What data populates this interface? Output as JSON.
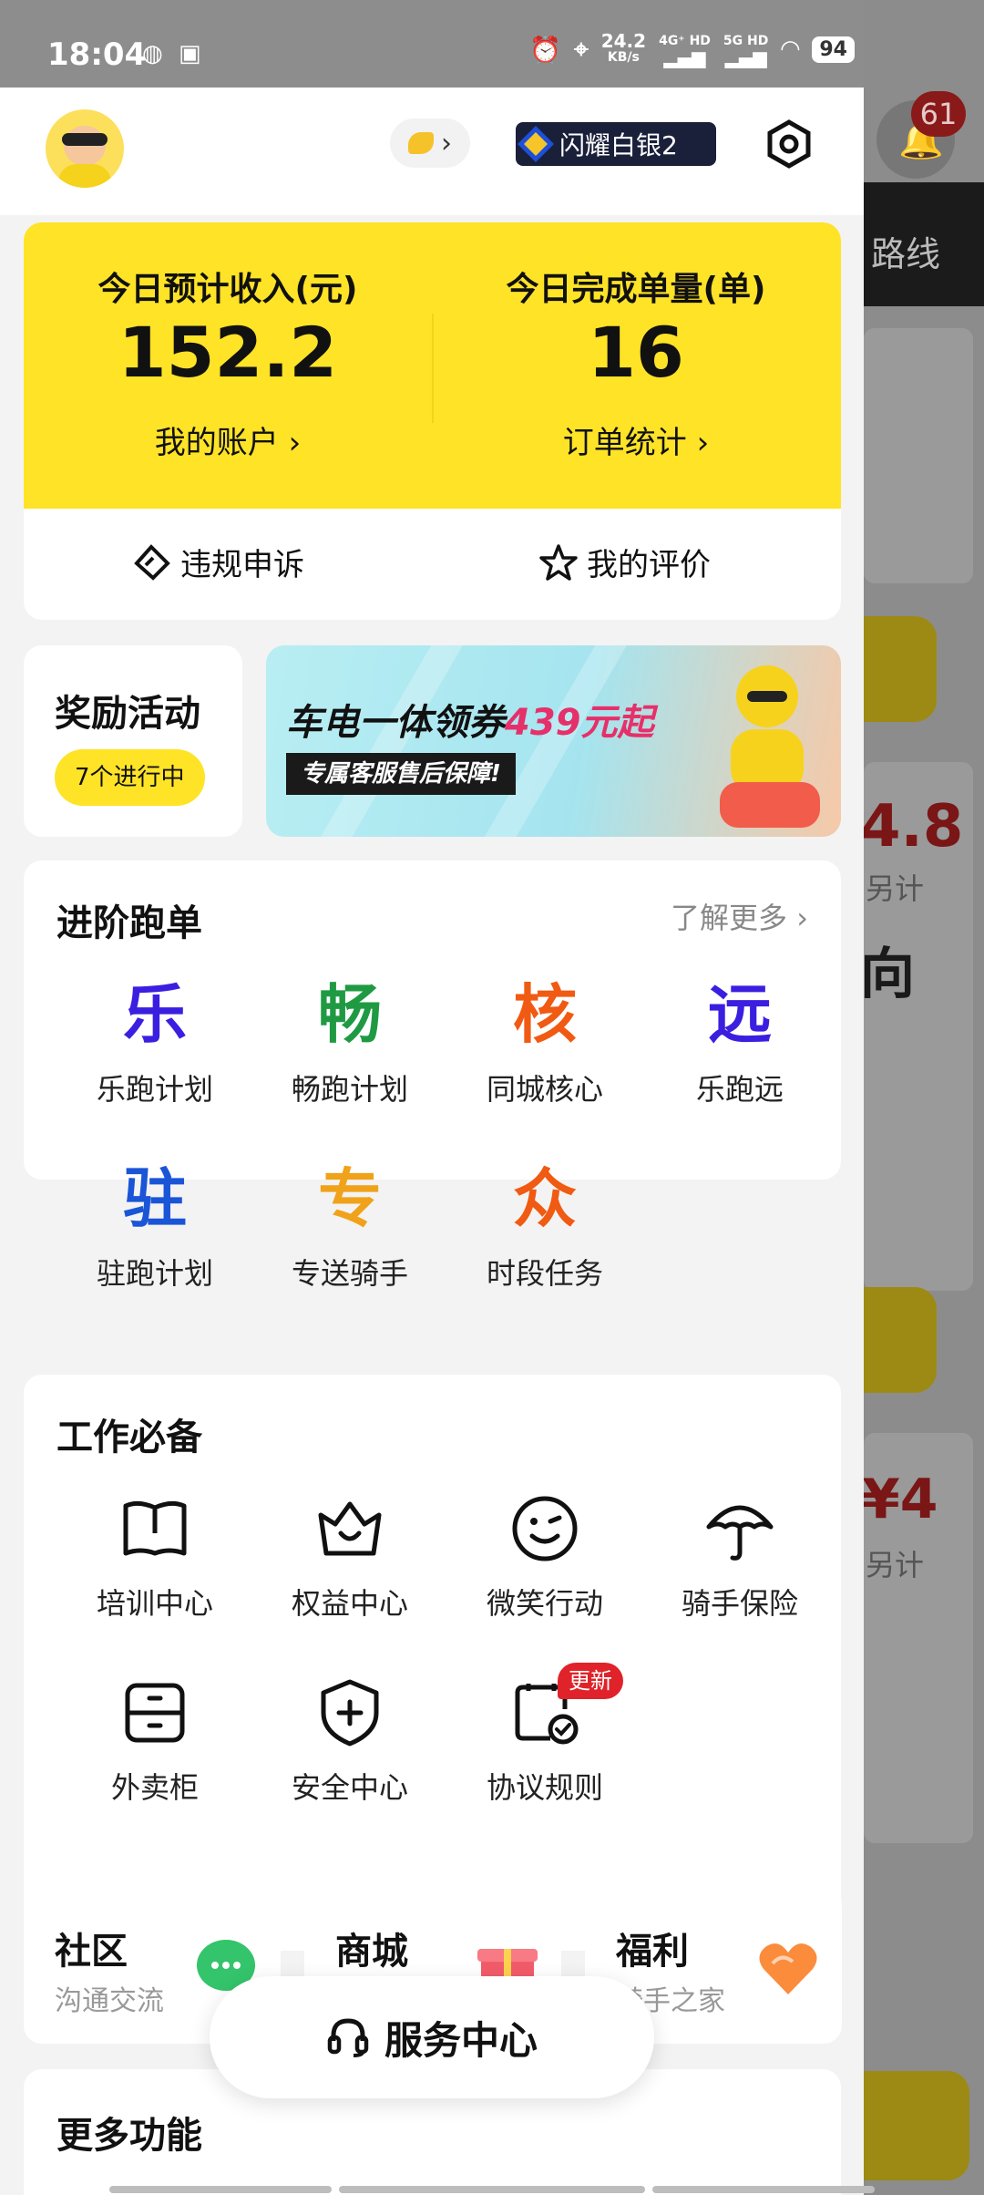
{
  "status_bar": {
    "time": "18:04",
    "speed_top": "24.2",
    "speed_unit": "KB/s",
    "net1": "4G⁺ HD",
    "net2": "5G HD",
    "battery": "94"
  },
  "background_app": {
    "route_label": "路线",
    "notification_count": "61",
    "amount1": "4.8",
    "amount2": "¥4",
    "note": "另计",
    "direction": "向"
  },
  "header": {
    "avatar": "avatar",
    "coin": "coin-icon",
    "rank": "闪耀白银2",
    "settings": "settings-icon"
  },
  "earnings": {
    "income_label": "今日预计收入(元)",
    "income_value": "152.2",
    "account_link": "我的账户",
    "orders_label": "今日完成单量(单)",
    "orders_value": "16",
    "stats_link": "订单统计"
  },
  "quick_actions": {
    "appeal": "违规申诉",
    "reviews": "我的评价"
  },
  "rewards": {
    "title": "奖励活动",
    "status": "7个进行中"
  },
  "banner": {
    "headline_a": "车电一体领券",
    "headline_b": "439元起",
    "sub": "专属客服售后保障!"
  },
  "advanced": {
    "title": "进阶跑单",
    "more": "了解更多",
    "items": [
      {
        "glyph": "乐",
        "label": "乐跑计划",
        "color": "#3a1fe0"
      },
      {
        "glyph": "畅",
        "label": "畅跑计划",
        "color": "#1f9a43"
      },
      {
        "glyph": "核",
        "label": "同城核心",
        "color": "#f05a12"
      },
      {
        "glyph": "远",
        "label": "乐跑远",
        "color": "#3a1fe0"
      },
      {
        "glyph": "驻",
        "label": "驻跑计划",
        "color": "#1a55d8"
      },
      {
        "glyph": "专",
        "label": "专送骑手",
        "color": "#f0a21a"
      },
      {
        "glyph": "众",
        "label": "时段任务",
        "color": "#f05a12"
      }
    ]
  },
  "essentials": {
    "title": "工作必备",
    "items": [
      {
        "label": "培训中心",
        "icon": "book-icon"
      },
      {
        "label": "权益中心",
        "icon": "crown-icon"
      },
      {
        "label": "微笑行动",
        "icon": "smile-icon"
      },
      {
        "label": "骑手保险",
        "icon": "umbrella-icon"
      },
      {
        "label": "外卖柜",
        "icon": "locker-icon"
      },
      {
        "label": "安全中心",
        "icon": "shield-icon"
      },
      {
        "label": "协议规则",
        "icon": "agreement-icon",
        "badge": "更新"
      }
    ]
  },
  "mini_cards": [
    {
      "title": "社区",
      "sub": "沟通交流",
      "icon": "chat-icon"
    },
    {
      "title": "商城",
      "sub": "",
      "icon": "gift-icon"
    },
    {
      "title": "福利",
      "sub": "骑手之家",
      "icon": "heart-icon"
    }
  ],
  "more_features": {
    "title": "更多功能"
  },
  "service_button": {
    "label": "服务中心",
    "icon": "headset-icon"
  }
}
